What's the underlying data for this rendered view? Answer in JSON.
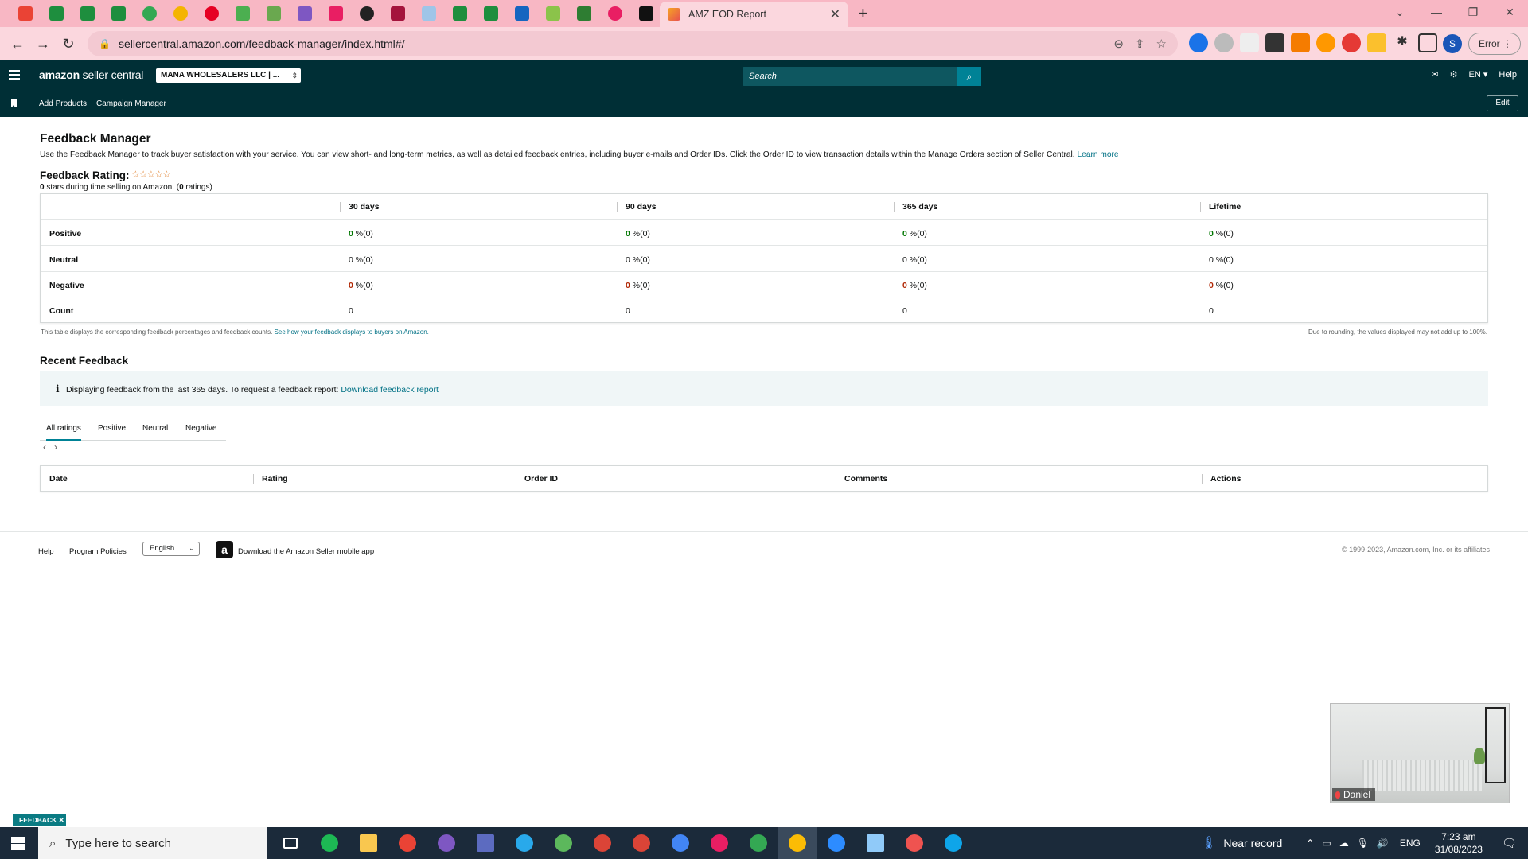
{
  "browser": {
    "active_tab_title": "AMZ EOD Report",
    "url": "sellercentral.amazon.com/feedback-manager/index.html#/",
    "error_button": "Error",
    "profile_initial": "S"
  },
  "header": {
    "logo_main": "amazon",
    "logo_sub": "seller central",
    "store": "MANA WHOLESALERS LLC | ...",
    "search_placeholder": "Search",
    "lang": "EN ▾",
    "help": "Help",
    "nav": [
      "Add Products",
      "Campaign Manager"
    ],
    "edit": "Edit"
  },
  "page": {
    "title": "Feedback Manager",
    "description": "Use the Feedback Manager to track buyer satisfaction with your service. You can view short- and long-term metrics, as well as detailed feedback entries, including buyer e-mails and Order IDs. Click the Order ID to view transaction details within the Manage Orders section of Seller Central.",
    "learn_more": "Learn more",
    "rating_label": "Feedback Rating:",
    "rating_stars": "☆☆☆☆☆",
    "rating_stars_value": 0,
    "rating_sub_pre": "0",
    "rating_sub_mid": " stars during time selling on Amazon. (",
    "rating_sub_count": "0",
    "rating_sub_post": " ratings)"
  },
  "metrics": {
    "columns": [
      "30 days",
      "90 days",
      "365 days",
      "Lifetime"
    ],
    "rows": [
      {
        "label": "Positive",
        "values": [
          "0",
          "0",
          "0",
          "0"
        ],
        "suffix": " %(0)"
      },
      {
        "label": "Neutral",
        "values": [
          "0",
          "0",
          "0",
          "0"
        ],
        "suffix": " %(0)"
      },
      {
        "label": "Negative",
        "values": [
          "0",
          "0",
          "0",
          "0"
        ],
        "suffix": " %(0)"
      },
      {
        "label": "Count",
        "values": [
          "0",
          "0",
          "0",
          "0"
        ],
        "suffix": ""
      }
    ],
    "note_left": "This table displays the corresponding feedback percentages and feedback counts.",
    "note_left_link": "See how your feedback displays to buyers on Amazon.",
    "note_right": "Due to rounding, the values displayed may not add up to 100%."
  },
  "recent": {
    "title": "Recent Feedback",
    "info_text": "Displaying feedback from the last 365 days. To request a feedback report:",
    "info_link": "Download feedback report",
    "tabs": [
      "All ratings",
      "Positive",
      "Neutral",
      "Negative"
    ],
    "columns": [
      "Date",
      "Rating",
      "Order ID",
      "Comments",
      "Actions"
    ]
  },
  "footer": {
    "help": "Help",
    "policies": "Program Policies",
    "language": "English",
    "app": "Download the Amazon Seller mobile app",
    "copyright": "© 1999-2023, Amazon.com, Inc. or its affiliates"
  },
  "overlay": {
    "camera_name": "Daniel",
    "feedback_tag": "FEEDBACK ✕"
  },
  "taskbar": {
    "search_placeholder": "Type here to search",
    "weather": "Near record",
    "lang": "ENG",
    "time": "7:23 am",
    "date": "31/08/2023"
  },
  "colors": {
    "tab_strip": "#f8b7c4",
    "header_bg": "#002f36",
    "link": "#007185",
    "positive": "#007600",
    "negative": "#b12704"
  }
}
